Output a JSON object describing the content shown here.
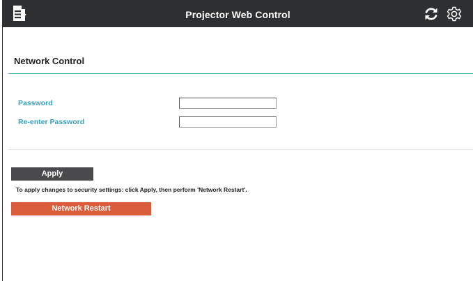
{
  "header": {
    "title": "Projector Web Control",
    "menu_icon": "menu-icon",
    "refresh_icon": "refresh-icon",
    "settings_icon": "gear-icon"
  },
  "main": {
    "section_title": "Network Control",
    "fields": [
      {
        "label": "Password",
        "value": ""
      },
      {
        "label": "Re-enter Password",
        "value": ""
      }
    ],
    "apply_label": "Apply",
    "note": "To apply changes to security settings: click Apply, then perform 'Network Restart'.",
    "restart_label": "Network Restart"
  },
  "colors": {
    "header_bg": "#2e2f31",
    "label_accent": "#34a2bf",
    "apply_bg": "#4a4a4c",
    "restart_bg": "#d95d3b"
  }
}
